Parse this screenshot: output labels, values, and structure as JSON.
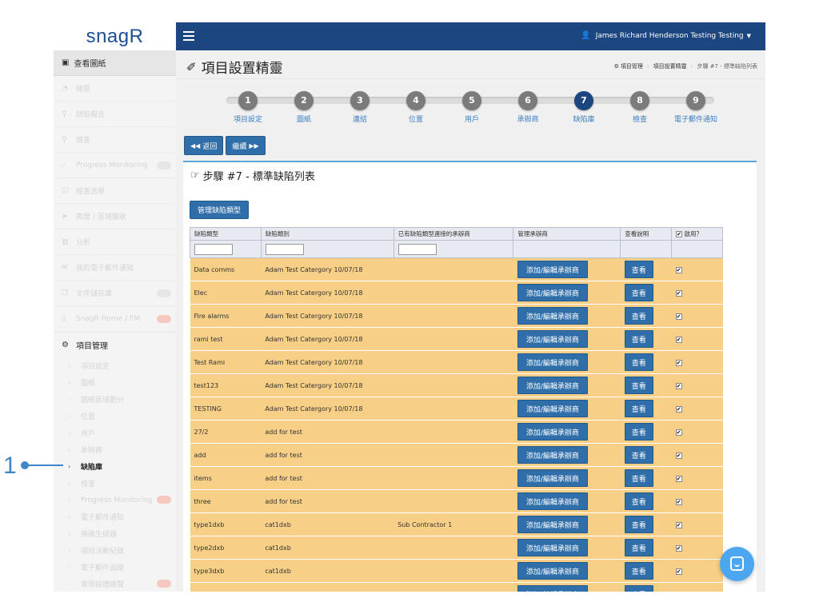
{
  "logo": "snagR",
  "sidebar": {
    "first": "查看圖紙",
    "items": [
      {
        "label": "總覽",
        "icon": "dashboard-icon",
        "pill": ""
      },
      {
        "label": "缺陷報告",
        "icon": "pin-icon",
        "pill": ""
      },
      {
        "label": "檢查",
        "icon": "search-icon",
        "pill": ""
      },
      {
        "label": "Progress Monitoring",
        "icon": "chart-line-icon",
        "pill": "grey"
      },
      {
        "label": "檢查清單",
        "icon": "checkbox-icon",
        "pill": ""
      },
      {
        "label": "房間 / 區域驗收",
        "icon": "plane-icon",
        "pill": ""
      },
      {
        "label": "分析",
        "icon": "bar-chart-icon",
        "pill": ""
      },
      {
        "label": "我的電子郵件通知",
        "icon": "envelope-icon",
        "pill": ""
      },
      {
        "label": "文件儲存庫",
        "icon": "file-icon",
        "pill": "grey"
      },
      {
        "label": "SnagR Home / FM",
        "icon": "document-icon",
        "pill": "red"
      }
    ],
    "section": "項目管理",
    "subitems": [
      {
        "label": "項目設定",
        "active": false,
        "pill": ""
      },
      {
        "label": "圖紙",
        "active": false,
        "pill": ""
      },
      {
        "label": "圖紙區域劃分",
        "active": false,
        "pill": ""
      },
      {
        "label": "位置",
        "active": false,
        "pill": ""
      },
      {
        "label": "用戶",
        "active": false,
        "pill": ""
      },
      {
        "label": "承辦商",
        "active": false,
        "pill": ""
      },
      {
        "label": "缺陷庫",
        "active": true,
        "pill": ""
      },
      {
        "label": "檢查",
        "active": false,
        "pill": ""
      },
      {
        "label": "Progress Monitoring",
        "active": false,
        "pill": "red"
      },
      {
        "label": "電子郵件通知",
        "active": false,
        "pill": ""
      },
      {
        "label": "條碼生成器",
        "active": false,
        "pill": ""
      },
      {
        "label": "項目活動紀錄",
        "active": false,
        "pill": ""
      },
      {
        "label": "電子郵件追蹤",
        "active": false,
        "pill": ""
      },
      {
        "label": "表現指標總覽",
        "active": false,
        "pill": "red"
      }
    ]
  },
  "annotation": "1",
  "topbar": {
    "user": "James Richard Henderson Testing Testing"
  },
  "header": {
    "title": "項目設置精靈",
    "breadcrumb": [
      "項目管理",
      "項目設置精靈",
      "步驟 #7 - 標準缺陷列表"
    ]
  },
  "wizard": {
    "steps": [
      {
        "num": "1",
        "label": "項目設定"
      },
      {
        "num": "2",
        "label": "圖紙"
      },
      {
        "num": "3",
        "label": "連結"
      },
      {
        "num": "4",
        "label": "位置"
      },
      {
        "num": "5",
        "label": "用戶"
      },
      {
        "num": "6",
        "label": "承辦商"
      },
      {
        "num": "7",
        "label": "缺陷庫"
      },
      {
        "num": "8",
        "label": "檢查"
      },
      {
        "num": "9",
        "label": "電子郵件通知"
      }
    ],
    "active": 7
  },
  "buttons": {
    "back": "返回",
    "next": "繼續"
  },
  "panel": {
    "title": "步驟 #7 - 標準缺陷列表",
    "manage": "管理缺陷類型"
  },
  "table": {
    "columns": [
      "缺陷類型",
      "缺陷類別",
      "已有缺陷類型連接的承辦商",
      "管理承辦商",
      "查看說明",
      "啟用？"
    ],
    "edit_label": "添加/編輯承辦商",
    "view_label": "查看",
    "rows": [
      {
        "type": "Data comms",
        "category": "Adam Test Catergory 10/07/18",
        "contractor": ""
      },
      {
        "type": "Elec",
        "category": "Adam Test Catergory 10/07/18",
        "contractor": ""
      },
      {
        "type": "Fire alarms",
        "category": "Adam Test Catergory 10/07/18",
        "contractor": ""
      },
      {
        "type": "rami test",
        "category": "Adam Test Catergory 10/07/18",
        "contractor": ""
      },
      {
        "type": "Test Rami",
        "category": "Adam Test Catergory 10/07/18",
        "contractor": ""
      },
      {
        "type": "test123",
        "category": "Adam Test Catergory 10/07/18",
        "contractor": ""
      },
      {
        "type": "TESTING",
        "category": "Adam Test Catergory 10/07/18",
        "contractor": ""
      },
      {
        "type": "27/2",
        "category": "add for test",
        "contractor": ""
      },
      {
        "type": "add",
        "category": "add for test",
        "contractor": ""
      },
      {
        "type": "items",
        "category": "add for test",
        "contractor": ""
      },
      {
        "type": "three",
        "category": "add for test",
        "contractor": ""
      },
      {
        "type": "type1dxb",
        "category": "cat1dxb",
        "contractor": "Sub Contractor 1"
      },
      {
        "type": "type2dxb",
        "category": "cat1dxb",
        "contractor": ""
      },
      {
        "type": "type3dxb",
        "category": "cat1dxb",
        "contractor": ""
      },
      {
        "type": "",
        "category": "",
        "contractor": ""
      }
    ]
  }
}
